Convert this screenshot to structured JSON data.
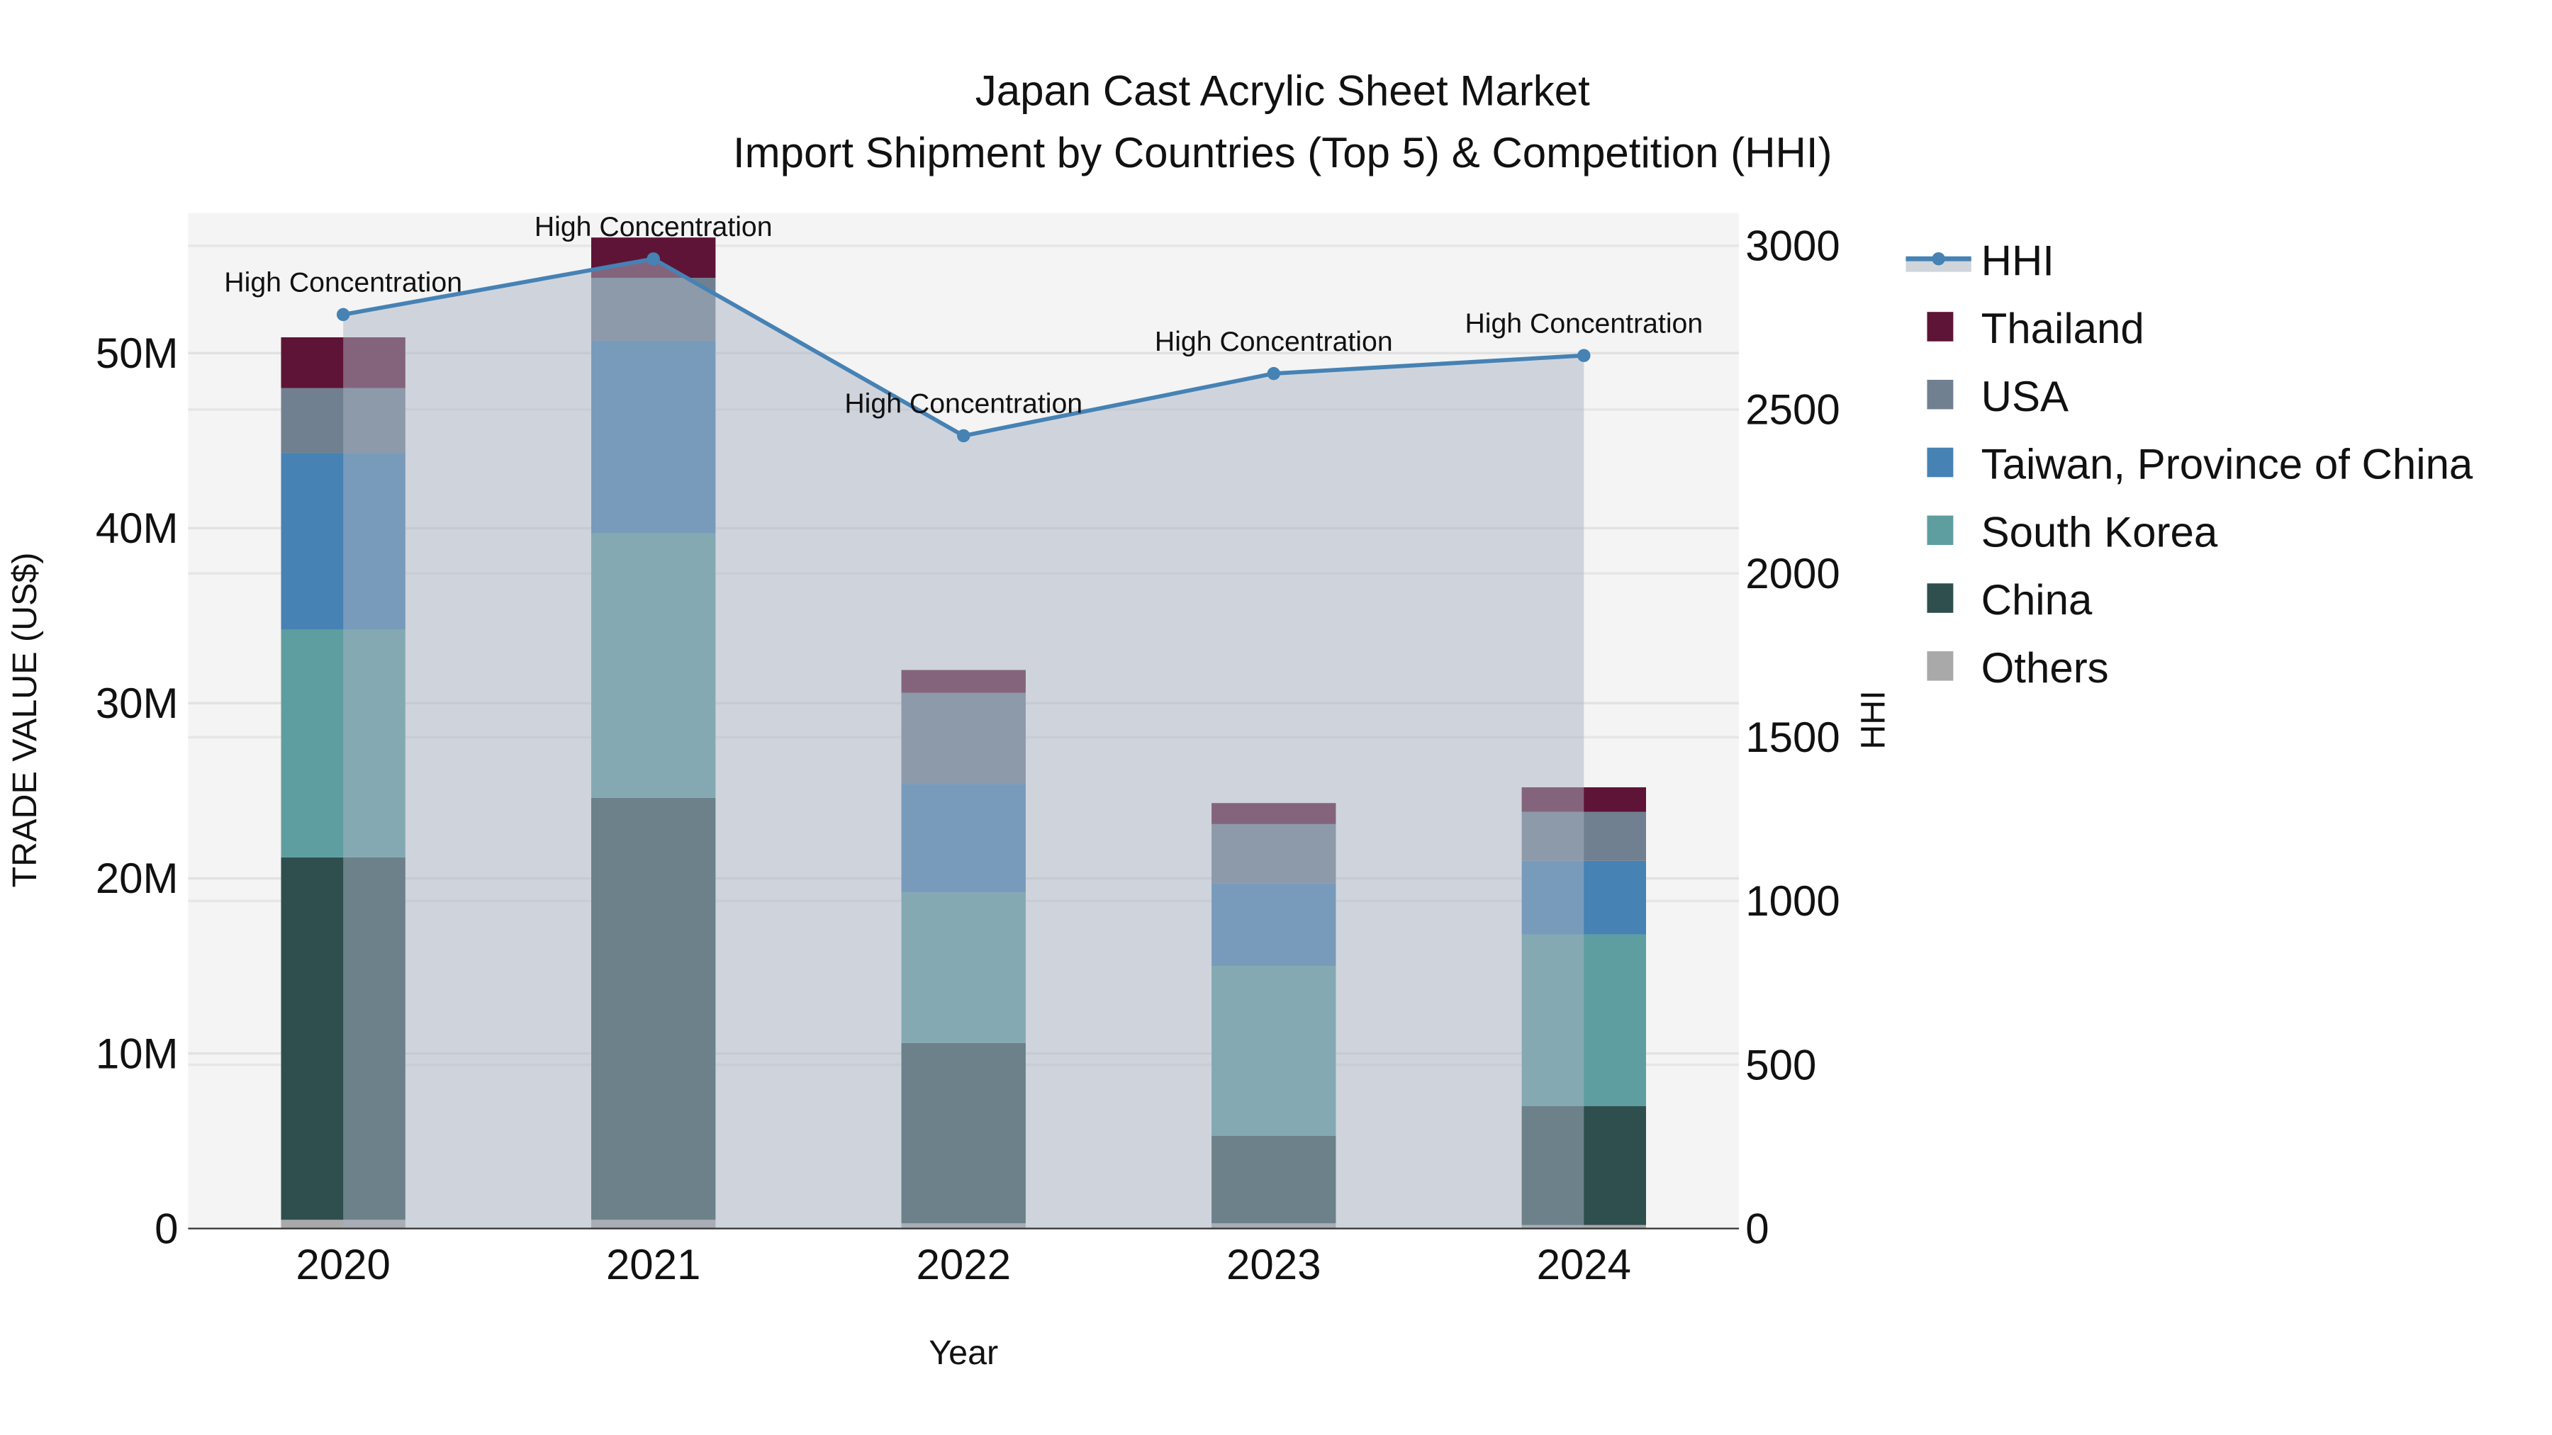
{
  "chart_data": {
    "type": "bar",
    "title": "Japan Cast Acrylic Sheet Market",
    "subtitle": "Import Shipment by Countries (Top 5) & Competition (HHI)",
    "xlabel": "Year",
    "ylabel": "TRADE VALUE (US$)",
    "y2label": "HHI",
    "categories": [
      "2020",
      "2021",
      "2022",
      "2023",
      "2024"
    ],
    "ylim": [
      0,
      58000000
    ],
    "y2lim": [
      0,
      3100
    ],
    "yticks": [
      {
        "v": 0,
        "label": "0"
      },
      {
        "v": 10000000,
        "label": "10M"
      },
      {
        "v": 20000000,
        "label": "20M"
      },
      {
        "v": 30000000,
        "label": "30M"
      },
      {
        "v": 40000000,
        "label": "40M"
      },
      {
        "v": 50000000,
        "label": "50M"
      }
    ],
    "y2ticks": [
      {
        "v": 0,
        "label": "0"
      },
      {
        "v": 500,
        "label": "500"
      },
      {
        "v": 1000,
        "label": "1000"
      },
      {
        "v": 1500,
        "label": "1500"
      },
      {
        "v": 2000,
        "label": "2000"
      },
      {
        "v": 2500,
        "label": "2500"
      },
      {
        "v": 3000,
        "label": "3000"
      }
    ],
    "series": [
      {
        "name": "Others",
        "color": "#a9a9a9",
        "values": [
          500000,
          500000,
          300000,
          300000,
          200000
        ]
      },
      {
        "name": "China",
        "color": "#2f4f4f",
        "values": [
          20700000,
          24100000,
          10300000,
          5000000,
          6800000
        ]
      },
      {
        "name": "South Korea",
        "color": "#5f9ea0",
        "values": [
          13000000,
          15100000,
          8600000,
          9700000,
          9800000
        ]
      },
      {
        "name": "Taiwan, Province of China",
        "color": "#4682b4",
        "values": [
          10100000,
          11000000,
          6200000,
          4700000,
          4200000
        ]
      },
      {
        "name": "USA",
        "color": "#708090",
        "values": [
          3700000,
          3600000,
          5200000,
          3400000,
          2800000
        ]
      },
      {
        "name": "Thailand",
        "color": "#5e1436",
        "values": [
          2900000,
          2300000,
          1300000,
          1200000,
          1400000
        ]
      }
    ],
    "hhi": {
      "name": "HHI",
      "color": "#4682b4",
      "values": [
        2790,
        2960,
        2420,
        2610,
        2665
      ],
      "annotations": [
        "High Concentration",
        "High Concentration",
        "High Concentration",
        "High Concentration",
        "High Concentration"
      ]
    },
    "legend": {
      "placement": "right",
      "order": [
        "HHI",
        "Thailand",
        "USA",
        "Taiwan, Province of China",
        "South Korea",
        "China",
        "Others"
      ]
    },
    "grid": true
  }
}
